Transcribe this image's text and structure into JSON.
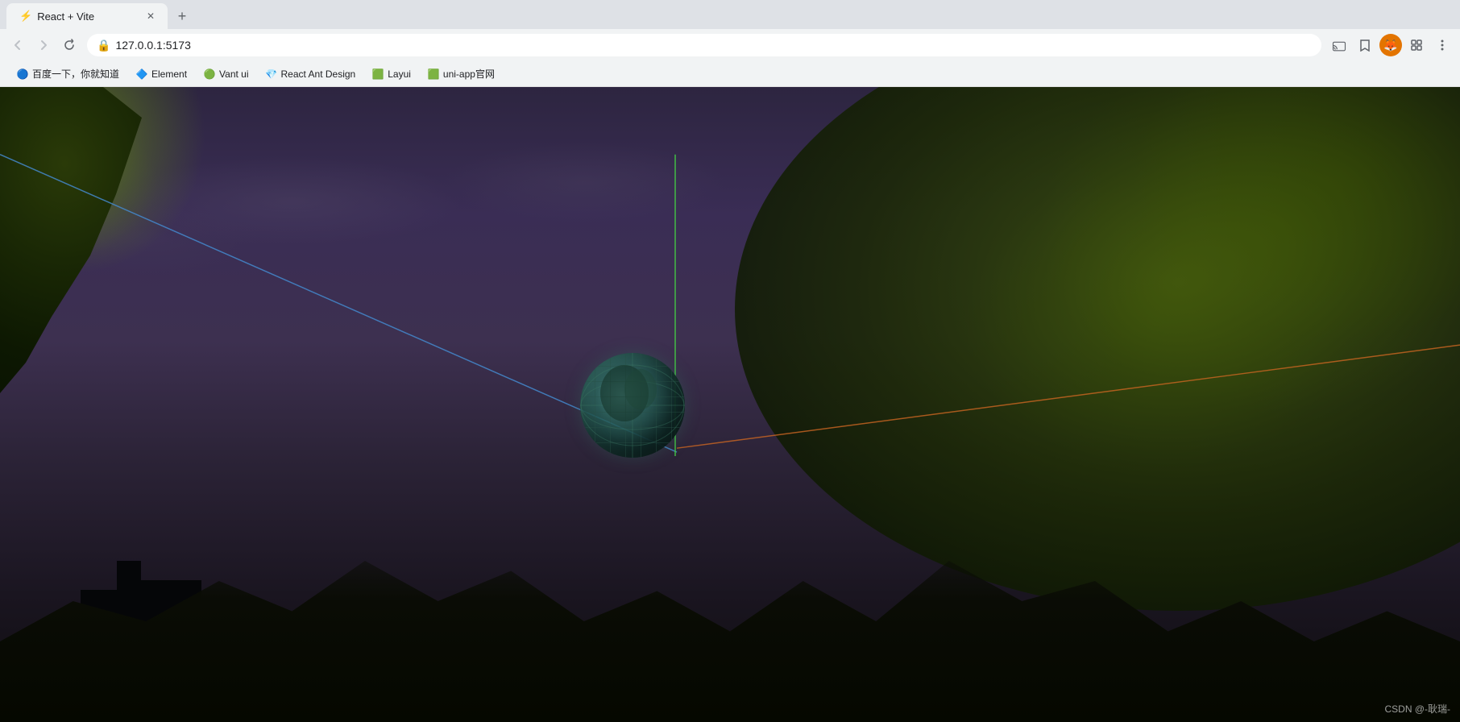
{
  "browser": {
    "url": "127.0.0.1:5173",
    "tab_title": "React + Vite"
  },
  "nav": {
    "back_title": "Back",
    "forward_title": "Forward",
    "reload_title": "Reload"
  },
  "bookmarks": [
    {
      "id": "baidu",
      "icon": "🔵",
      "label": "百度一下，你就知道"
    },
    {
      "id": "element",
      "icon": "🔷",
      "label": "Element"
    },
    {
      "id": "vant",
      "icon": "🟢",
      "label": "Vant ui"
    },
    {
      "id": "react-ant",
      "icon": "💎",
      "label": "React Ant Design"
    },
    {
      "id": "layui",
      "icon": "🟩",
      "label": "Layui"
    },
    {
      "id": "uniapp",
      "icon": "🟩",
      "label": "uni-app官网"
    }
  ],
  "watermark": {
    "text": "CSDN @-耿瑞-"
  },
  "scene": {
    "description": "Night scene with trees and 3D visualization lines"
  }
}
